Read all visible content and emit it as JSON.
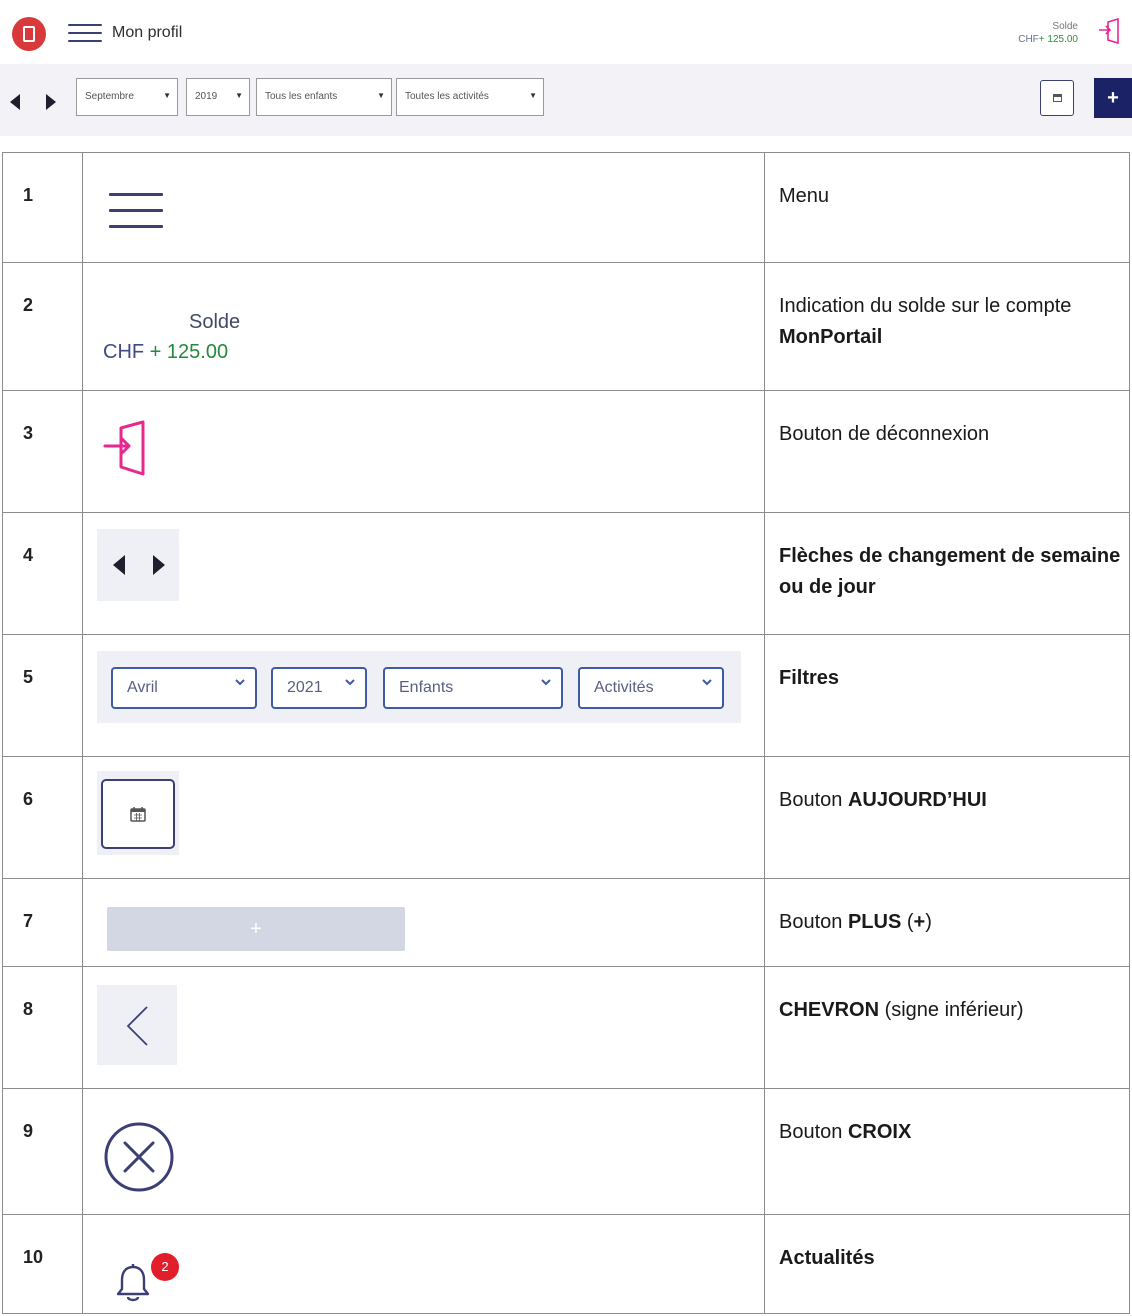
{
  "header": {
    "title": "Mon profil",
    "solde_label": "Solde",
    "solde_currency": "CHF",
    "solde_amount": "+ 125.00"
  },
  "toolbar": {
    "filters": [
      "Septembre",
      "2019",
      "Tous les enfants",
      "Toutes les activités"
    ],
    "plus_label": "+"
  },
  "legend": {
    "rows": [
      {
        "num": "1",
        "desc_parts": [
          [
            "Menu",
            false
          ]
        ]
      },
      {
        "num": "2",
        "desc_parts": [
          [
            "Indication du solde sur le compte ",
            false
          ],
          [
            "MonPortail",
            true
          ]
        ],
        "solde_label": "Solde",
        "solde_currency": "CHF",
        "solde_amount": "+ 125.00"
      },
      {
        "num": "3",
        "desc_parts": [
          [
            "Bouton de déconnexion",
            false
          ]
        ]
      },
      {
        "num": "4",
        "desc_parts": [
          [
            "Flèches de changement de semaine ou de jour",
            true
          ]
        ]
      },
      {
        "num": "5",
        "desc_parts": [
          [
            "Filtres",
            true
          ]
        ],
        "filters": [
          "Avril",
          "2021",
          "Enfants",
          "Activités"
        ]
      },
      {
        "num": "6",
        "desc_parts": [
          [
            "Bouton ",
            false
          ],
          [
            "AUJOURD’HUI",
            true
          ]
        ]
      },
      {
        "num": "7",
        "desc_parts": [
          [
            "Bouton ",
            false
          ],
          [
            "PLUS",
            true
          ],
          [
            " (",
            false
          ],
          [
            "+",
            true
          ],
          [
            ")",
            false
          ]
        ],
        "plus_label": "+"
      },
      {
        "num": "8",
        "desc_parts": [
          [
            "CHEVRON",
            true
          ],
          [
            " (signe inférieur)",
            false
          ]
        ]
      },
      {
        "num": "9",
        "desc_parts": [
          [
            "Bouton ",
            false
          ],
          [
            "CROIX",
            true
          ]
        ]
      },
      {
        "num": "10",
        "desc_parts": [
          [
            "Actualités",
            true
          ]
        ],
        "badge_count": "2"
      }
    ]
  },
  "colors": {
    "navy": "#1b2366",
    "logout_pink": "#e8288f",
    "balance_green": "#238a3a",
    "badge_red": "#e21e2a"
  }
}
